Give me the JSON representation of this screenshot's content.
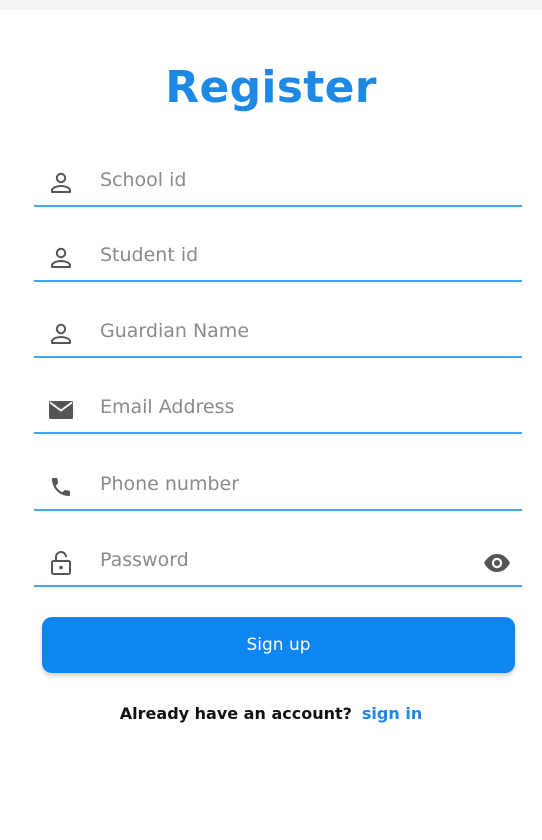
{
  "title": "Register",
  "fields": [
    {
      "label": "School id",
      "icon": "person-icon"
    },
    {
      "label": "Student id",
      "icon": "person-icon"
    },
    {
      "label": "Guardian Name",
      "icon": "person-icon"
    },
    {
      "label": "Email Address",
      "icon": "mail-icon"
    },
    {
      "label": "Phone number",
      "icon": "phone-icon"
    },
    {
      "label": "Password",
      "icon": "lock-icon",
      "trailing_icon": "eye-icon"
    }
  ],
  "signup_label": "Sign up",
  "footer": {
    "prompt": "Already have an account?",
    "link": "sign in"
  },
  "colors": {
    "accent": "#1e88e5",
    "button": "#0d86f2",
    "underline": "#42a5f5",
    "placeholder": "#8a8a8a",
    "icon": "#555555"
  }
}
